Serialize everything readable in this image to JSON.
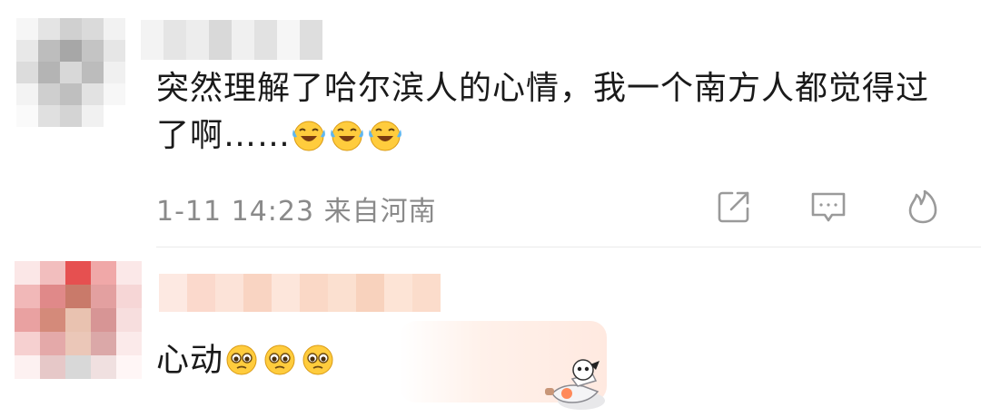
{
  "comments": [
    {
      "text": "突然理解了哈尔滨人的心情，我一个南方人都觉得过了啊……",
      "emoji": "laughing-crying",
      "emoji_count": 3,
      "time": "1-11 14:23",
      "location": "来自河南",
      "actions": [
        "share-icon",
        "comment-icon",
        "like-flame-icon"
      ]
    },
    {
      "text": "心动",
      "emoji": "pleading-face",
      "emoji_count": 3
    }
  ],
  "colors": {
    "text": "#1a1a1a",
    "meta": "#8a8a8a",
    "divider": "#eaeaea"
  }
}
